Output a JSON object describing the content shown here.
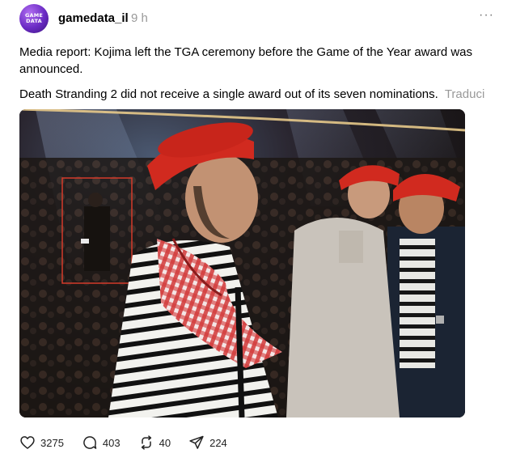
{
  "post": {
    "avatar_text_line1": "GAME",
    "avatar_text_line2": "DATA",
    "username": "gamedata_il",
    "time": "9 h",
    "more": "···",
    "paragraph1": "Media report: Kojima left the TGA ceremony before the Game of the Year award was announced.",
    "paragraph2": "Death Stranding 2 did not receive a single award out of its seven nominations.",
    "translate_label": "Traduci"
  },
  "actions": {
    "likes": "3275",
    "replies": "403",
    "reposts": "40",
    "shares": "224"
  },
  "icons": {
    "like": "heart-icon",
    "reply": "comment-icon",
    "repost": "repost-icon",
    "share": "send-icon",
    "more": "more-dots-icon"
  },
  "colors": {
    "avatar": "#6a2bc4",
    "muted": "#999999",
    "highlight_box": "#d43a2a"
  }
}
